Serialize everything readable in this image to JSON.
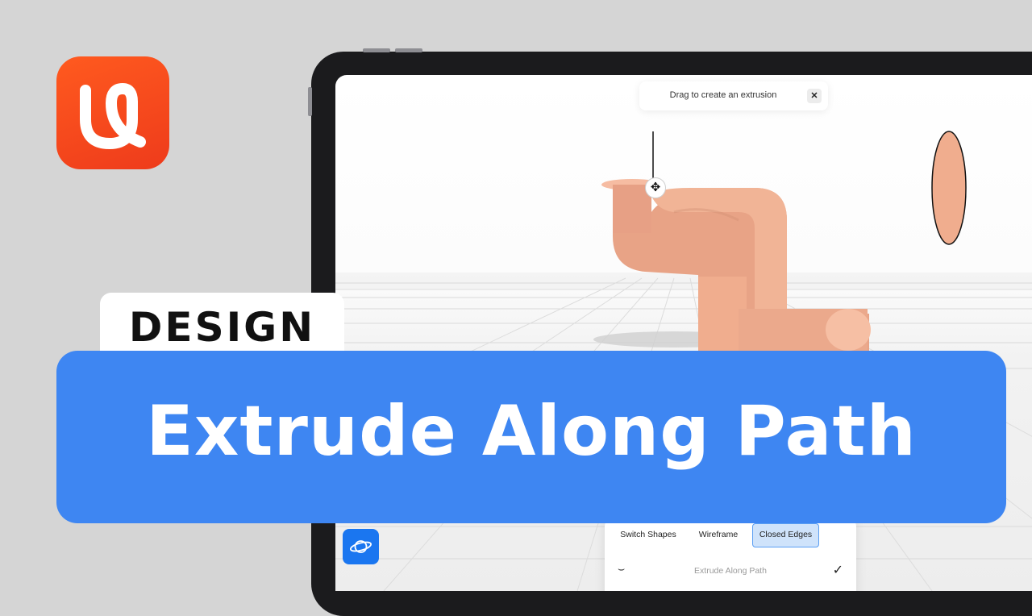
{
  "app": {
    "name": "app-logo",
    "icon_color": "#f04e1e"
  },
  "toast": {
    "message": "Drag to create an extrusion",
    "close_symbol": "✕"
  },
  "gizmo": {
    "symbol": "✥"
  },
  "panel": {
    "buttons": [
      {
        "label": "Switch Shapes",
        "active": false
      },
      {
        "label": "Wireframe",
        "active": false
      },
      {
        "label": "Closed Edges",
        "active": true
      }
    ],
    "row": {
      "label": "Extrude Along Path",
      "icon": "⌣",
      "check": "✓"
    }
  },
  "overlay": {
    "category": "DESIGN",
    "title": "Extrude Along Path"
  },
  "colors": {
    "accent": "#3e86f2",
    "shape": "#f0ad8e",
    "button": "#1a76f0"
  }
}
